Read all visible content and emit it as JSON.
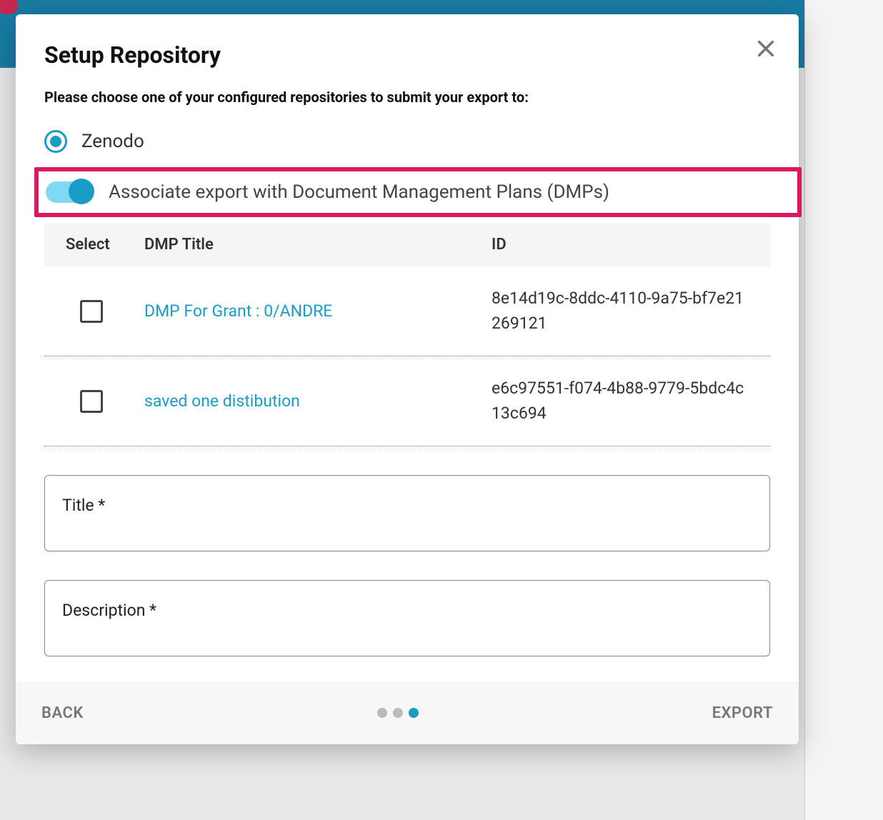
{
  "modal": {
    "title": "Setup Repository",
    "instruction": "Please choose one of your configured repositories to submit your export to:",
    "close_icon": "close"
  },
  "repository": {
    "option_label": "Zenodo",
    "selected": true
  },
  "toggle": {
    "label": "Associate export with Document Management Plans (DMPs)",
    "enabled": true
  },
  "table": {
    "headers": {
      "select": "Select",
      "title": "DMP Title",
      "id": "ID"
    },
    "rows": [
      {
        "title": "DMP For Grant : 0/ANDRE",
        "id": "8e14d19c-8ddc-4110-9a75-bf7e21269121",
        "checked": false
      },
      {
        "title": "saved one distibution",
        "id": "e6c97551-f074-4b88-9779-5bdc4c13c694",
        "checked": false
      }
    ]
  },
  "form": {
    "title_label": "Title *",
    "description_label": "Description *"
  },
  "footer": {
    "back_label": "BACK",
    "export_label": "EXPORT",
    "step_active": 3,
    "step_total": 3
  },
  "colors": {
    "accent": "#1a9cc7",
    "highlight": "#d81b60"
  }
}
